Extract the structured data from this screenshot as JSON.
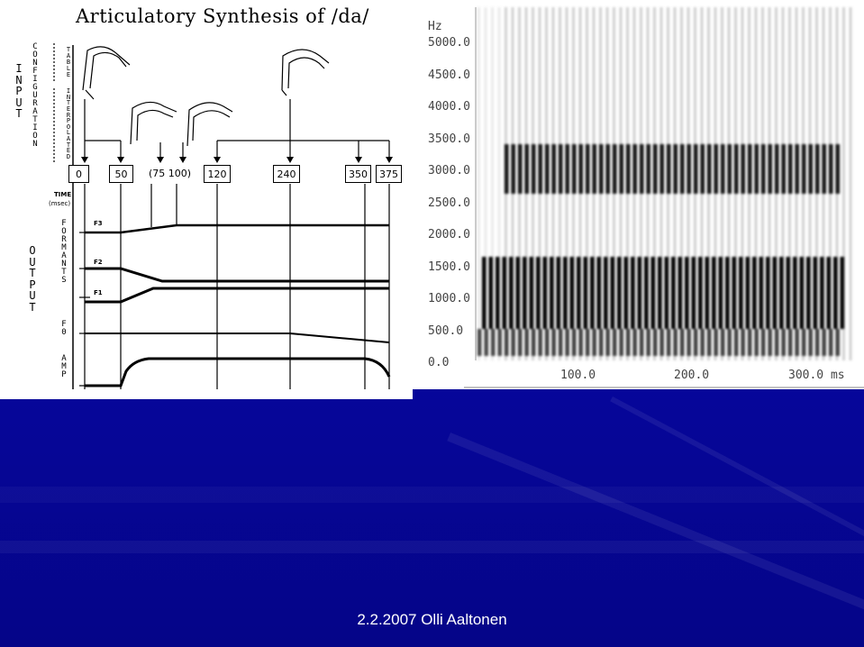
{
  "title": "Articulatory Synthesis of /da/",
  "left": {
    "input_label": "INPUT",
    "configuration_label": "CONFIGURATION",
    "table_label": "TABLE",
    "interpolated_label": "INTERPOLATED",
    "output_label": "OUTPUT",
    "time_label": "TIME",
    "msec_label": "(msec)",
    "formants_label": "FORMANTS",
    "f3": "F3",
    "f2": "F2",
    "f1": "F1",
    "f0_label": "F0",
    "amp_label": "AMP",
    "time_boxes": [
      "0",
      "50",
      "120",
      "240",
      "350",
      "375"
    ],
    "paren_times": "(75 100)"
  },
  "spectrogram": {
    "hz_unit": "Hz",
    "y_ticks": [
      "5000.0",
      "4500.0",
      "4000.0",
      "3500.0",
      "3000.0",
      "2500.0",
      "2000.0",
      "1500.0",
      "1000.0",
      "500.0",
      "0.0"
    ],
    "x_ticks": [
      "100.0",
      "200.0",
      "300.0 ms"
    ]
  },
  "footer": "2.2.2007 Olli Aaltonen"
}
